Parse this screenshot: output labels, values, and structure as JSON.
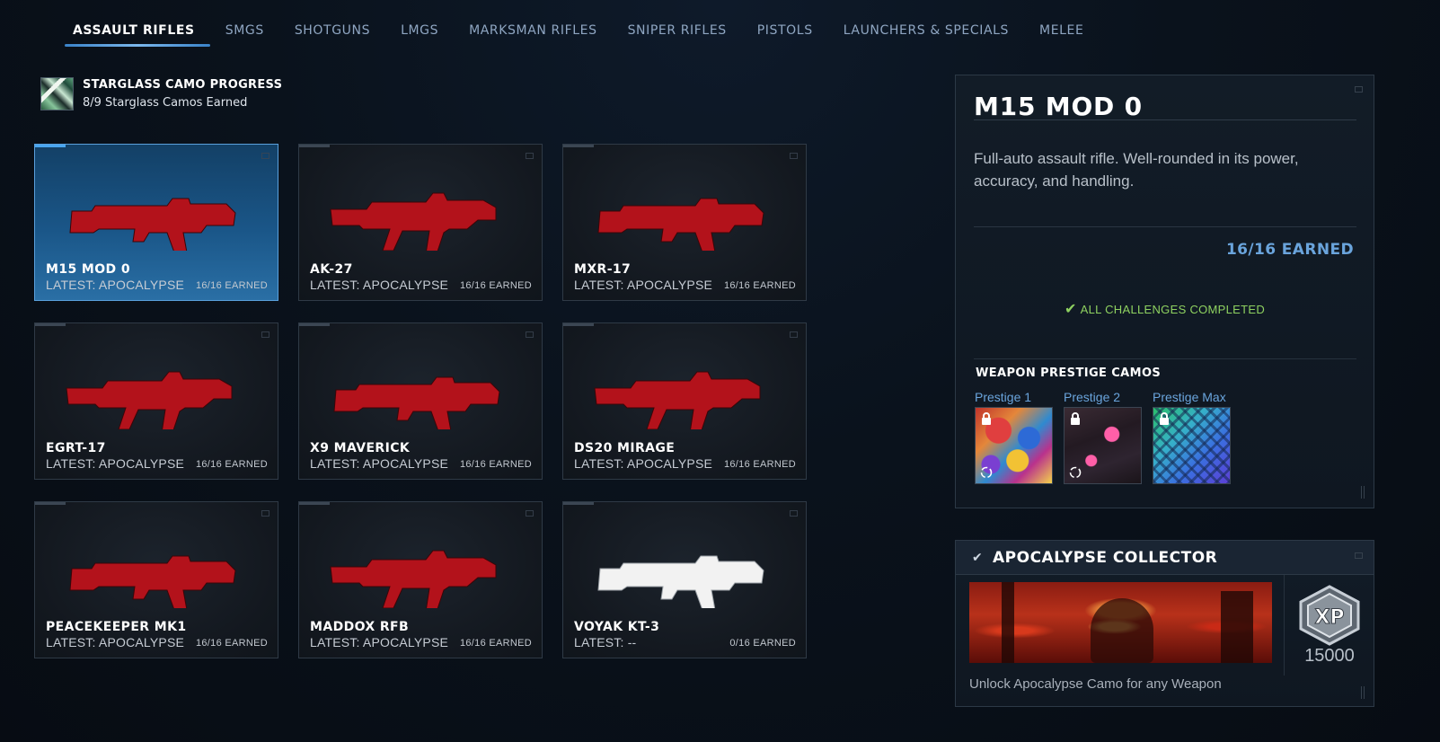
{
  "tabs": [
    {
      "label": "ASSAULT RIFLES",
      "active": true
    },
    {
      "label": "SMGS",
      "active": false
    },
    {
      "label": "SHOTGUNS",
      "active": false
    },
    {
      "label": "LMGS",
      "active": false
    },
    {
      "label": "MARKSMAN RIFLES",
      "active": false
    },
    {
      "label": "SNIPER RIFLES",
      "active": false
    },
    {
      "label": "PISTOLS",
      "active": false
    },
    {
      "label": "LAUNCHERS & SPECIALS",
      "active": false
    },
    {
      "label": "MELEE",
      "active": false
    }
  ],
  "progress": {
    "icon": "starglass-camo-icon",
    "title": "STARGLASS CAMO PROGRESS",
    "subtitle": "8/9 Starglass Camos Earned"
  },
  "weapons": [
    {
      "name": "M15 MOD 0",
      "latest": "LATEST: APOCALYPSE",
      "earned": "16/16 EARNED",
      "selected": true,
      "camo": "red"
    },
    {
      "name": "AK-27",
      "latest": "LATEST: APOCALYPSE",
      "earned": "16/16 EARNED",
      "selected": false,
      "camo": "red"
    },
    {
      "name": "MXR-17",
      "latest": "LATEST: APOCALYPSE",
      "earned": "16/16 EARNED",
      "selected": false,
      "camo": "red"
    },
    {
      "name": "EGRT-17",
      "latest": "LATEST: APOCALYPSE",
      "earned": "16/16 EARNED",
      "selected": false,
      "camo": "red"
    },
    {
      "name": "X9 MAVERICK",
      "latest": "LATEST: APOCALYPSE",
      "earned": "16/16 EARNED",
      "selected": false,
      "camo": "red"
    },
    {
      "name": "DS20 MIRAGE",
      "latest": "LATEST: APOCALYPSE",
      "earned": "16/16 EARNED",
      "selected": false,
      "camo": "red"
    },
    {
      "name": "PEACEKEEPER MK1",
      "latest": "LATEST: APOCALYPSE",
      "earned": "16/16 EARNED",
      "selected": false,
      "camo": "red"
    },
    {
      "name": "MADDOX RFB",
      "latest": "LATEST: APOCALYPSE",
      "earned": "16/16 EARNED",
      "selected": false,
      "camo": "red"
    },
    {
      "name": "VOYAK KT-3",
      "latest": "LATEST: --",
      "earned": "0/16 EARNED",
      "selected": false,
      "camo": "white"
    }
  ],
  "detail": {
    "title": "M15 MOD 0",
    "description": "Full-auto assault rifle. Well-rounded in its power, accuracy, and handling.",
    "earned": "16/16 EARNED",
    "status": "ALL CHALLENGES COMPLETED",
    "prestige_title": "WEAPON PRESTIGE CAMOS",
    "prestige_camos": [
      {
        "label": "Prestige 1",
        "style": "graffiti",
        "locked": true
      },
      {
        "label": "Prestige 2",
        "style": "cards",
        "locked": true
      },
      {
        "label": "Prestige Max",
        "style": "scales",
        "locked": true
      }
    ]
  },
  "challenge": {
    "title": "APOCALYPSE COLLECTOR",
    "xp_label": "XP",
    "xp_amount": "15000",
    "description": "Unlock Apocalypse Camo for any Weapon"
  },
  "colors": {
    "accent": "#6aa4dc",
    "success": "#8ed160",
    "camo_red": "#b3121b",
    "selected_card": "#1a5688"
  }
}
